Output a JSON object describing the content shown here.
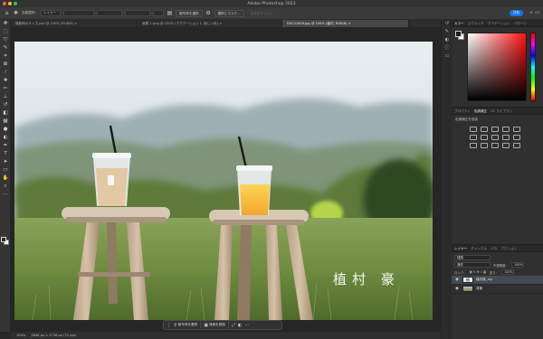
{
  "app": {
    "title": "Adobe Photoshop 2023"
  },
  "options_bar": {
    "auto_select_label": "自動選択：",
    "auto_select_value": "レイヤー",
    "transform_label": "バウンディングボックスを表示",
    "three_d_label": "3D モード：",
    "mode_label": "",
    "share_label": "共有",
    "select_subject_label": "被写体を選択",
    "select_and_mask_label": "選択とマスク...",
    "generative_label": "生成塗りつぶし"
  },
  "tabs": [
    {
      "label": "撮影時のサイズ.psd @ 100% (RGB/8) ×",
      "active": false
    },
    {
      "label": "無題-1.png @ 100% (グラデーション 1, 新しい色) ×",
      "active": false
    },
    {
      "label": "DSC01849.jpg @ 100% (植村, RGB/8) ×",
      "active": true
    }
  ],
  "photo": {
    "signature": "植村 豪"
  },
  "context_bar": {
    "select_subject": "被写体を選択",
    "remove_background": "背景を削除"
  },
  "status": {
    "zoom": "100%",
    "info": "3648 px × 2736 px (72 ppi)"
  },
  "panels": {
    "color_tabs": [
      "カラー",
      "スウォッチ",
      "グラデーション",
      "パターン"
    ],
    "props_tabs": [
      "プロパティ",
      "色調補正",
      "CC ライブラリ"
    ],
    "props_title": "色調補正を追加",
    "layers_tabs": [
      "レイヤー",
      "チャンネル",
      "パス",
      "アクション"
    ],
    "kind_label": "種類",
    "blend_mode": "通常",
    "opacity_label": "不透明度：",
    "opacity_value": "100%",
    "lock_label": "ロック：",
    "fill_label": "塗り：",
    "fill_value": "100%",
    "layers": [
      {
        "name": "植村豪_sig",
        "type": "text",
        "active": true
      },
      {
        "name": "背景",
        "type": "photo",
        "active": false
      }
    ]
  },
  "colors": {
    "accent": "#1473e6",
    "foreground": "#1b1b1b",
    "background": "#ffffff"
  }
}
